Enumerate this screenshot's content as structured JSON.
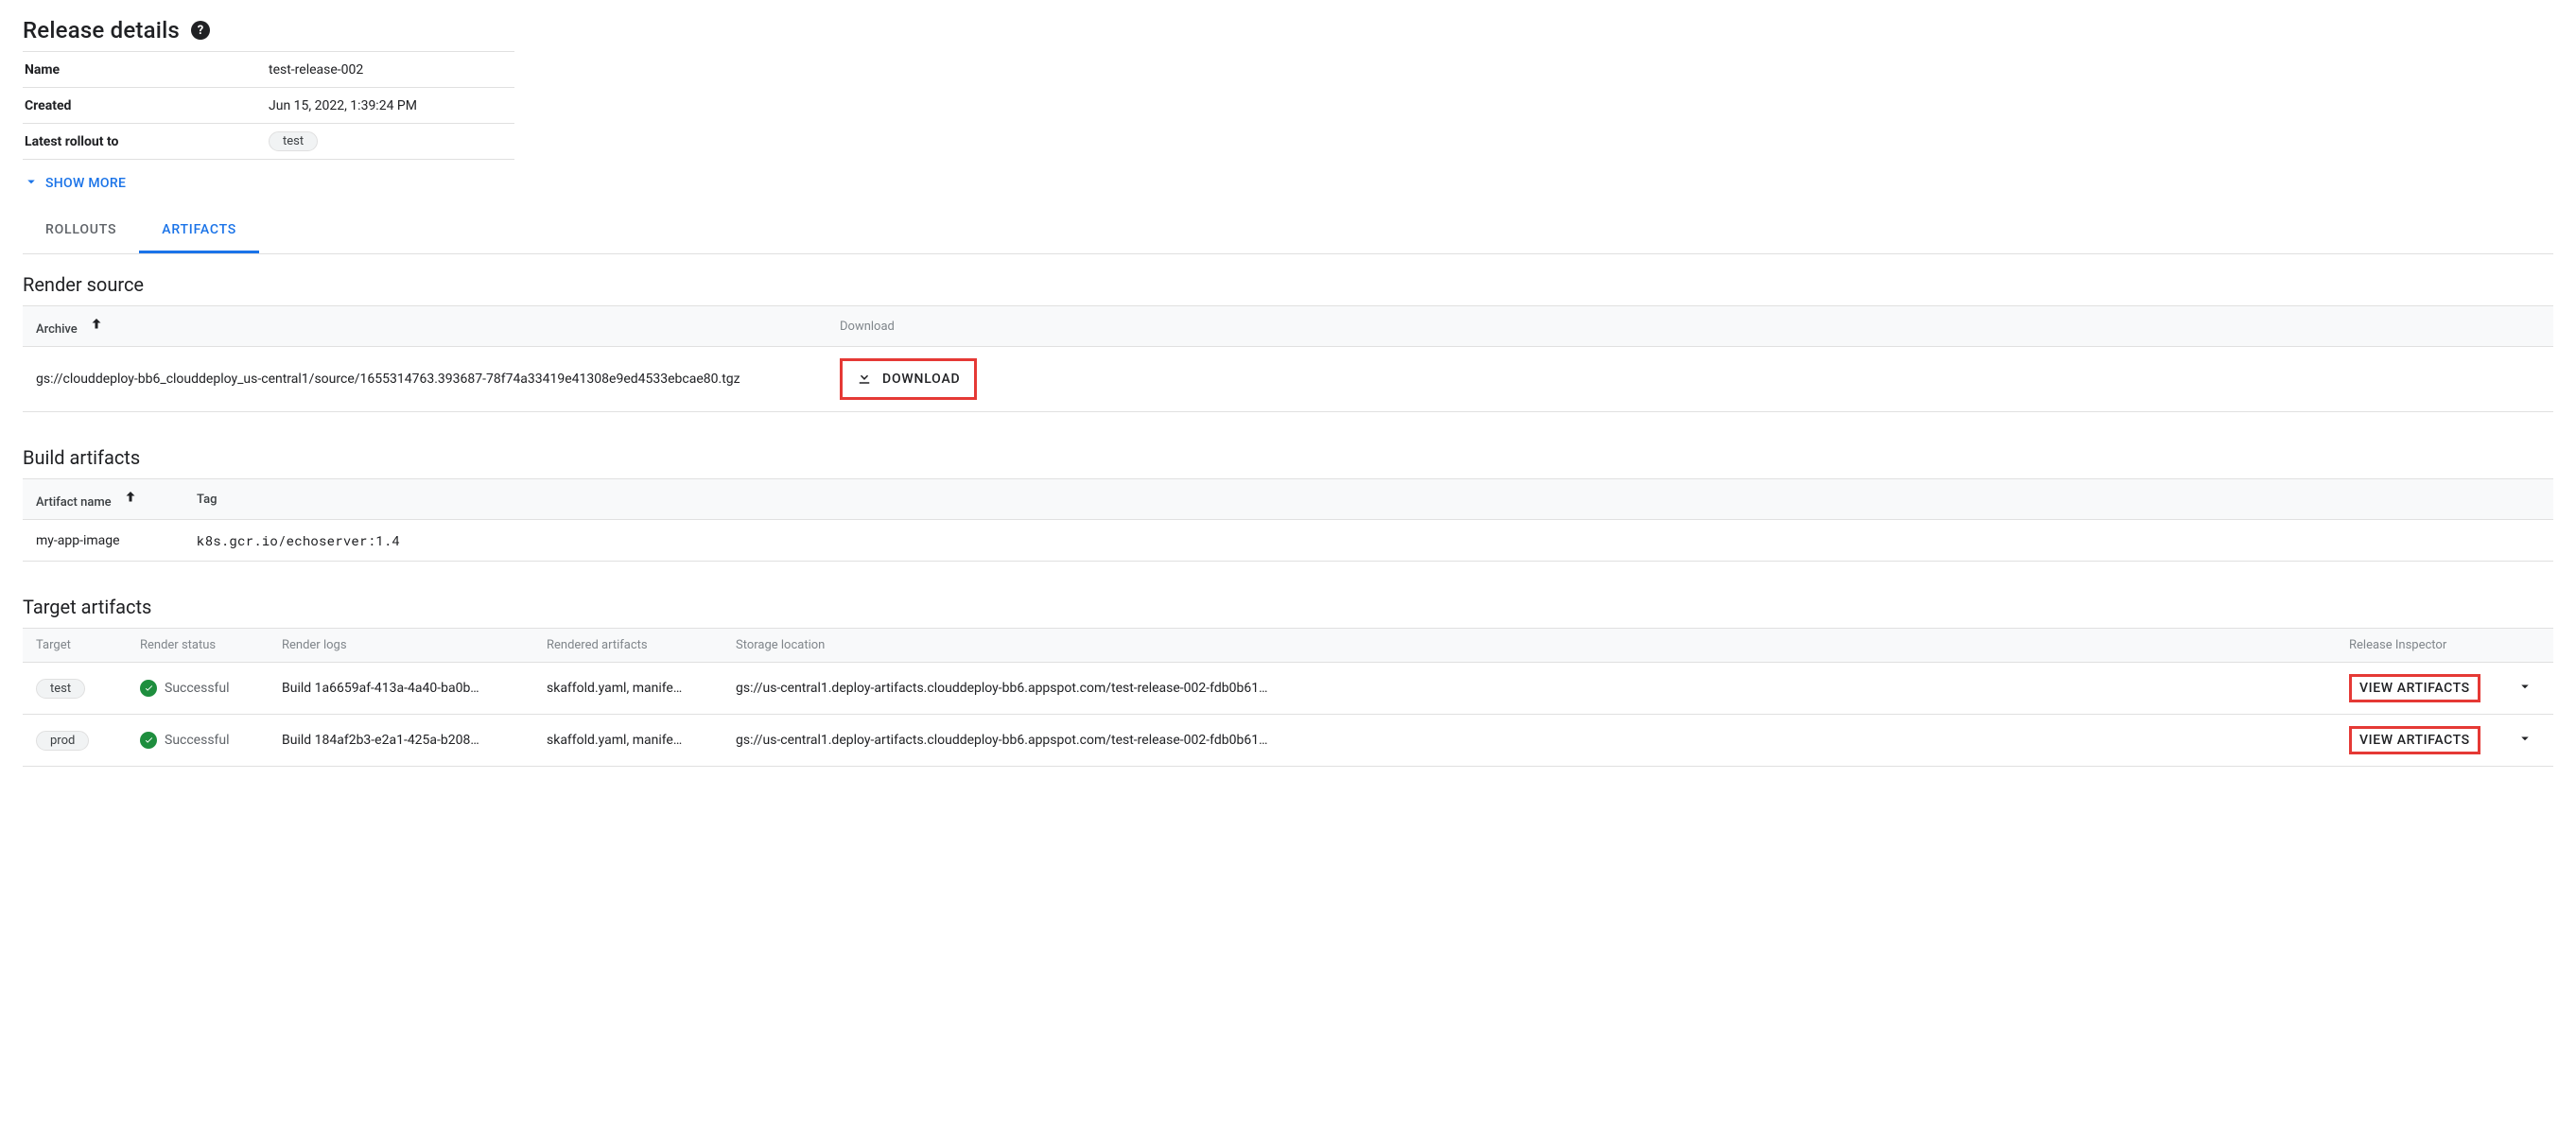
{
  "header": {
    "title": "Release details",
    "help_glyph": "?"
  },
  "details": {
    "rows": [
      {
        "key": "Name",
        "value": "test-release-002",
        "chip": false
      },
      {
        "key": "Created",
        "value": "Jun 15, 2022, 1:39:24 PM",
        "chip": false
      },
      {
        "key": "Latest rollout to",
        "value": "test",
        "chip": true
      }
    ],
    "show_more_label": "SHOW MORE"
  },
  "tabs": {
    "items": [
      {
        "label": "ROLLOUTS",
        "active": false
      },
      {
        "label": "ARTIFACTS",
        "active": true
      }
    ]
  },
  "render_source": {
    "title": "Render source",
    "columns": {
      "archive": "Archive",
      "download": "Download"
    },
    "row": {
      "archive": "gs://clouddeploy-bb6_clouddeploy_us-central1/source/1655314763.393687-78f74a33419e41308e9ed4533ebcae80.tgz",
      "download_label": "DOWNLOAD"
    }
  },
  "build_artifacts": {
    "title": "Build artifacts",
    "columns": {
      "name": "Artifact name",
      "tag": "Tag"
    },
    "rows": [
      {
        "name": "my-app-image",
        "tag": "k8s.gcr.io/echoserver:1.4"
      }
    ]
  },
  "target_artifacts": {
    "title": "Target artifacts",
    "columns": {
      "target": "Target",
      "render_status": "Render status",
      "render_logs": "Render logs",
      "rendered_artifacts": "Rendered artifacts",
      "storage_location": "Storage location",
      "release_inspector": "Release Inspector"
    },
    "status_success_label": "Successful",
    "view_artifacts_label": "VIEW ARTIFACTS",
    "rows": [
      {
        "target": "test",
        "render_logs": "Build 1a6659af-413a-4a40-ba0b…",
        "rendered_artifacts": "skaffold.yaml, manife…",
        "storage_location": "gs://us-central1.deploy-artifacts.clouddeploy-bb6.appspot.com/test-release-002-fdb0b61…"
      },
      {
        "target": "prod",
        "render_logs": "Build 184af2b3-e2a1-425a-b208…",
        "rendered_artifacts": "skaffold.yaml, manife…",
        "storage_location": "gs://us-central1.deploy-artifacts.clouddeploy-bb6.appspot.com/test-release-002-fdb0b61…"
      }
    ]
  }
}
